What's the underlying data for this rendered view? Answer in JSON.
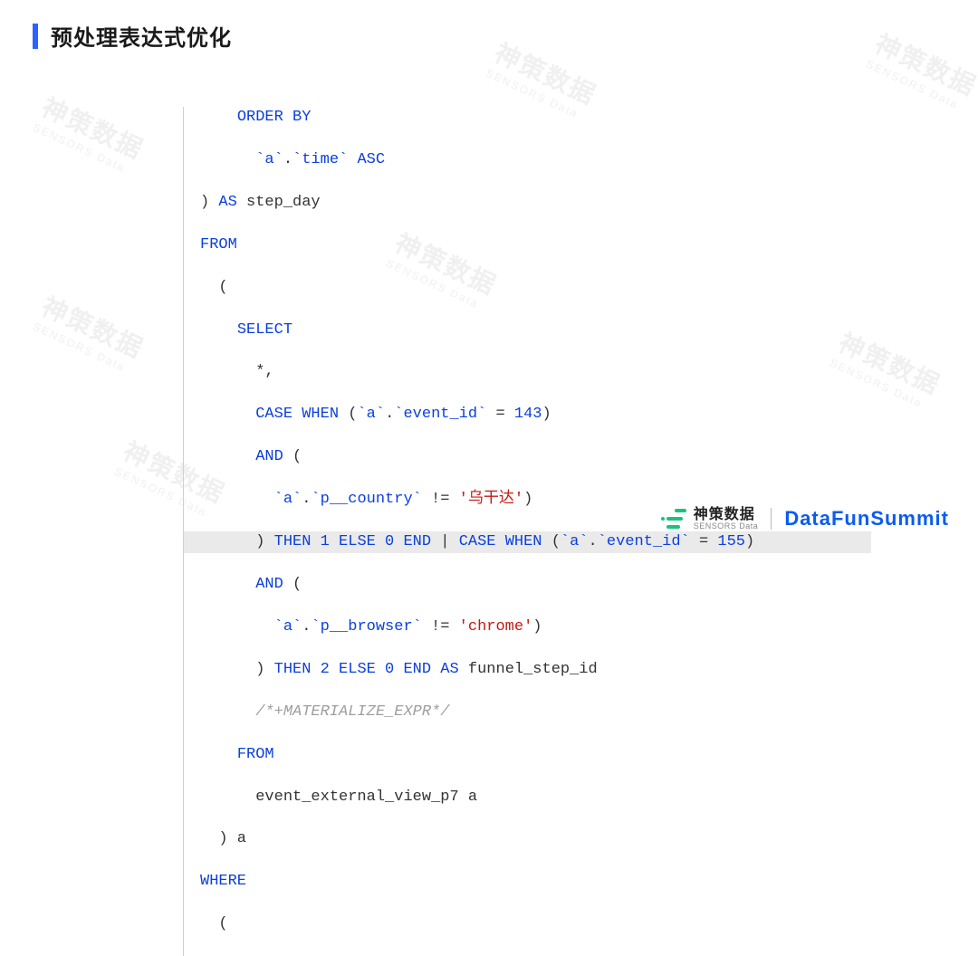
{
  "title": "预处理表达式优化",
  "code": {
    "l1": {
      "kw1": "ORDER BY"
    },
    "l2": {
      "tk1": "`a`",
      "dot": ".",
      "tk2": "`time`",
      "kw1": "ASC"
    },
    "l3": {
      "p": ") ",
      "kw1": "AS",
      "ident": " step_day"
    },
    "l4": {
      "kw1": "FROM"
    },
    "l5": {
      "p": "("
    },
    "l6": {
      "kw1": "SELECT"
    },
    "l7": {
      "star": "*,"
    },
    "l8": {
      "kw1": "CASE WHEN",
      "p1": " (",
      "tk1": "`a`",
      "dot": ".",
      "tk2": "`event_id`",
      "eq": " = ",
      "num": "143",
      "p2": ")"
    },
    "l9": {
      "kw1": "AND",
      "p": " ("
    },
    "l10": {
      "tk1": "`a`",
      "dot": ".",
      "tk2": "`p__country`",
      "neq": " != ",
      "str": "'乌干达'",
      "p": ")"
    },
    "l11": {
      "p1": ") ",
      "kw1": "THEN",
      "num1": " 1 ",
      "kw2": "ELSE",
      "num0": " 0 ",
      "kw3": "END",
      "bar": " | ",
      "kw4": "CASE WHEN",
      "p2": " (",
      "tk1": "`a`",
      "dot": ".",
      "tk2": "`event_id`",
      "eq": " = ",
      "num2": "155",
      "p3": ")"
    },
    "l12": {
      "kw1": "AND",
      "p": " ("
    },
    "l13": {
      "tk1": "`a`",
      "dot": ".",
      "tk2": "`p__browser`",
      "neq": " != ",
      "str": "'chrome'",
      "p": ")"
    },
    "l14": {
      "p1": ") ",
      "kw1": "THEN",
      "num1": " 2 ",
      "kw2": "ELSE",
      "num0": " 0 ",
      "kw3": "END",
      "kw4": " AS",
      "ident": " funnel_step_id"
    },
    "l15": {
      "cmt": "/*+MATERIALIZE_EXPR*/"
    },
    "l16": {
      "kw1": "FROM"
    },
    "l17": {
      "ident": "event_external_view_p7 a"
    },
    "l18": {
      "p": ") a"
    },
    "l19": {
      "kw1": "WHERE"
    },
    "l20": {
      "p": "("
    }
  },
  "footer": {
    "sensors_cn": "神策数据",
    "sensors_en": "SENSORS Data",
    "dfs": "DataFunSummit"
  },
  "watermark": {
    "cn": "神策数据",
    "en": "SENSORS Data"
  }
}
